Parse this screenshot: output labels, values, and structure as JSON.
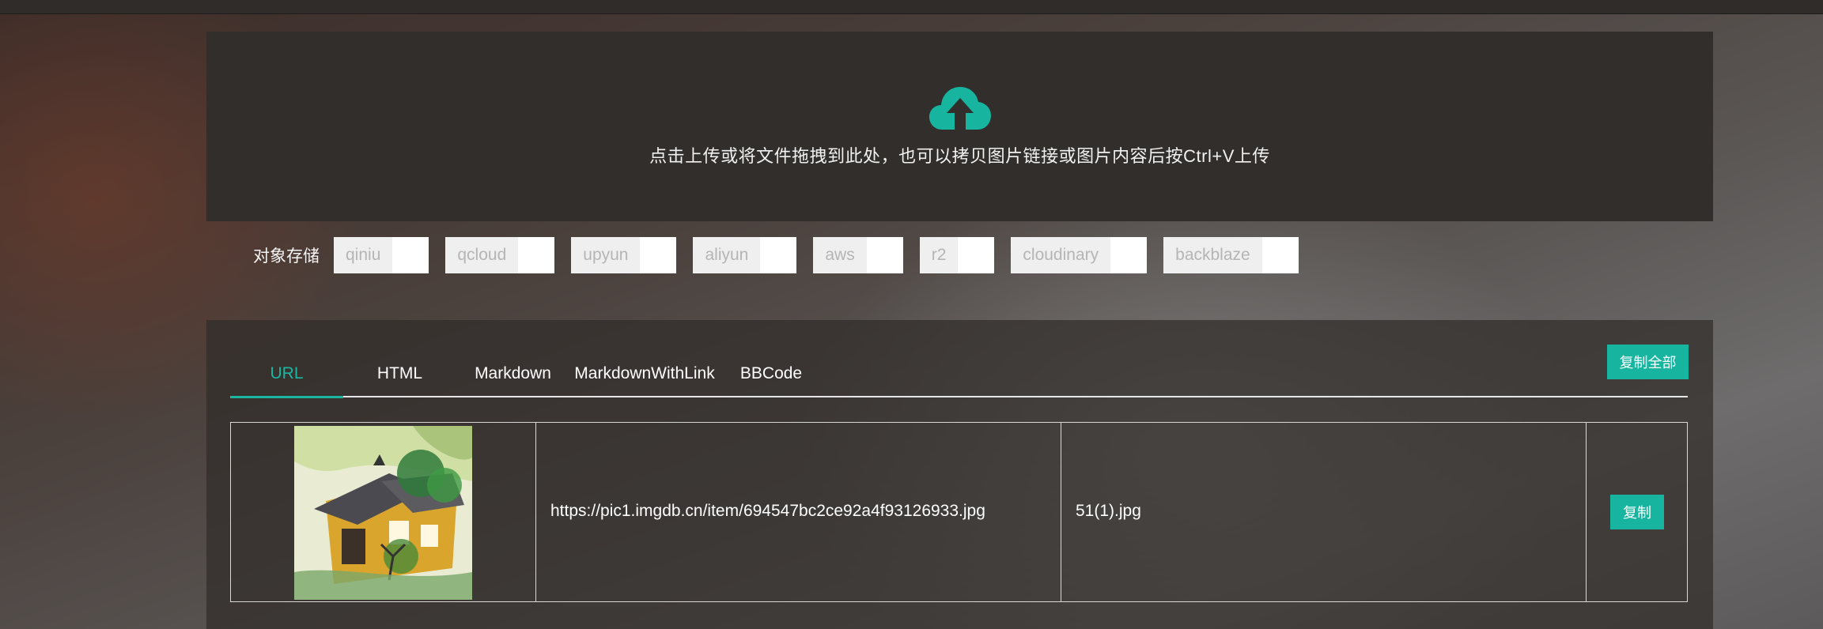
{
  "upload": {
    "icon": "cloud-upload-icon",
    "hint": "点击上传或将文件拖拽到此处，也可以拷贝图片链接或图片内容后按Ctrl+V上传"
  },
  "storage": {
    "label": "对象存储",
    "options": [
      "qiniu",
      "qcloud",
      "upyun",
      "aliyun",
      "aws",
      "r2",
      "cloudinary",
      "backblaze"
    ]
  },
  "tabs": [
    "URL",
    "HTML",
    "Markdown",
    "MarkdownWithLink",
    "BBCode"
  ],
  "active_tab": "URL",
  "copy_all_label": "复制全部",
  "rows": [
    {
      "url": "https://pic1.imgdb.cn/item/694547bc2ce92a4f93126933.jpg",
      "filename": "51(1).jpg",
      "copy_label": "复制"
    }
  ],
  "colors": {
    "accent": "#17b5a0",
    "panel": "#312e2b"
  }
}
